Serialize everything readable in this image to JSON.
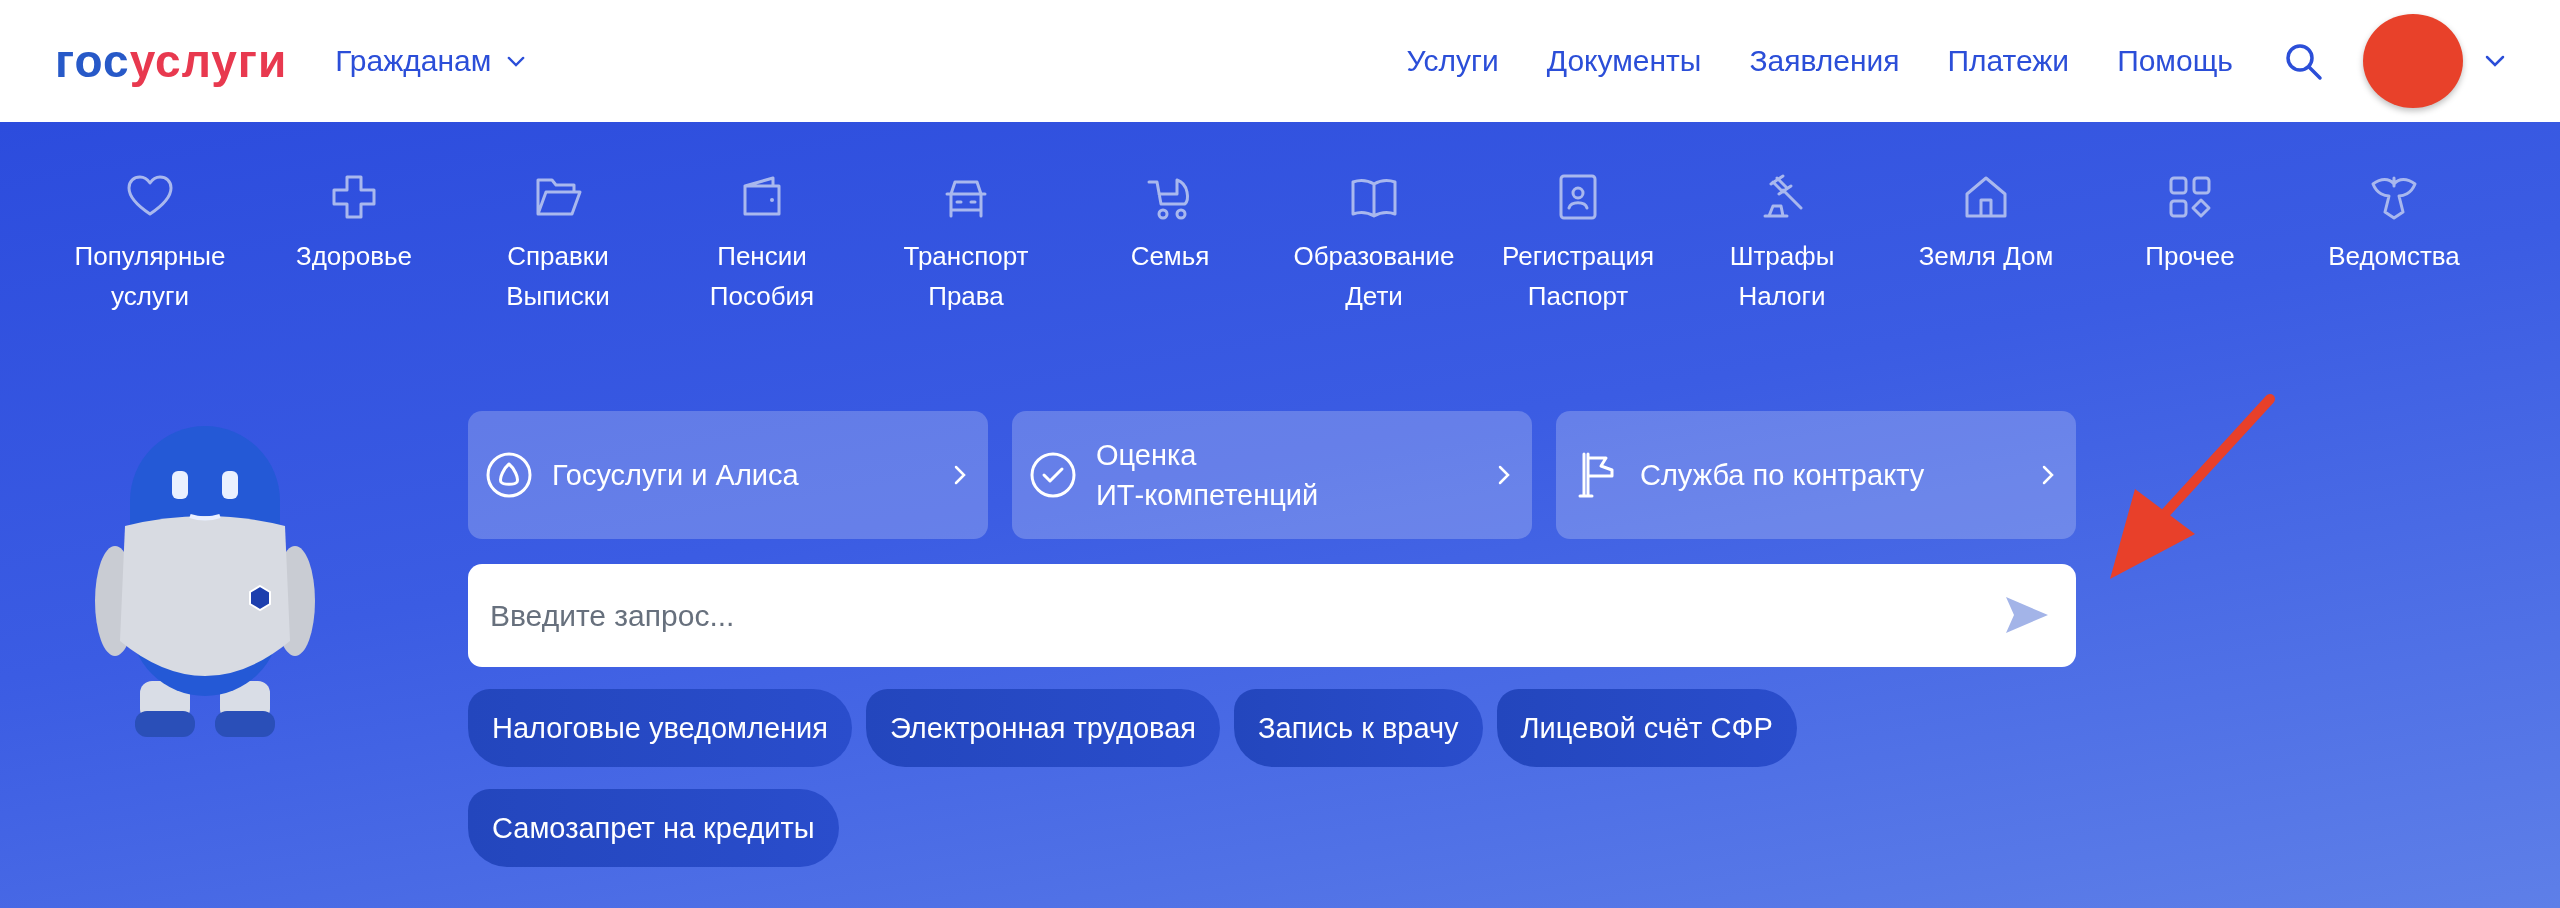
{
  "header": {
    "logo": {
      "first": "гос",
      "second": "услуги"
    },
    "audience_menu": {
      "label": "Гражданам"
    },
    "nav": [
      {
        "label": "Услуги"
      },
      {
        "label": "Документы"
      },
      {
        "label": "Заявления"
      },
      {
        "label": "Платежи"
      },
      {
        "label": "Помощь"
      }
    ]
  },
  "categories": [
    {
      "label": "Популярные\nуслуги"
    },
    {
      "label": "Здоровье"
    },
    {
      "label": "Справки\nВыписки"
    },
    {
      "label": "Пенсии\nПособия"
    },
    {
      "label": "Транспорт\nПрава"
    },
    {
      "label": "Семья"
    },
    {
      "label": "Образование\nДети"
    },
    {
      "label": "Регистрация\nПаспорт"
    },
    {
      "label": "Штрафы\nНалоги"
    },
    {
      "label": "Земля Дом"
    },
    {
      "label": "Прочее"
    },
    {
      "label": "Ведомства"
    }
  ],
  "promo_cards": [
    {
      "label": "Госуслуги и Алиса"
    },
    {
      "label": "Оценка\nИТ-компетенций"
    },
    {
      "label": "Служба по контракту"
    }
  ],
  "search": {
    "placeholder": "Введите запрос..."
  },
  "quick_links": [
    "Налоговые уведомления",
    "Электронная трудовая",
    "Запись к врачу",
    "Лицевой счёт СФР",
    "Самозапрет на кредиты"
  ]
}
